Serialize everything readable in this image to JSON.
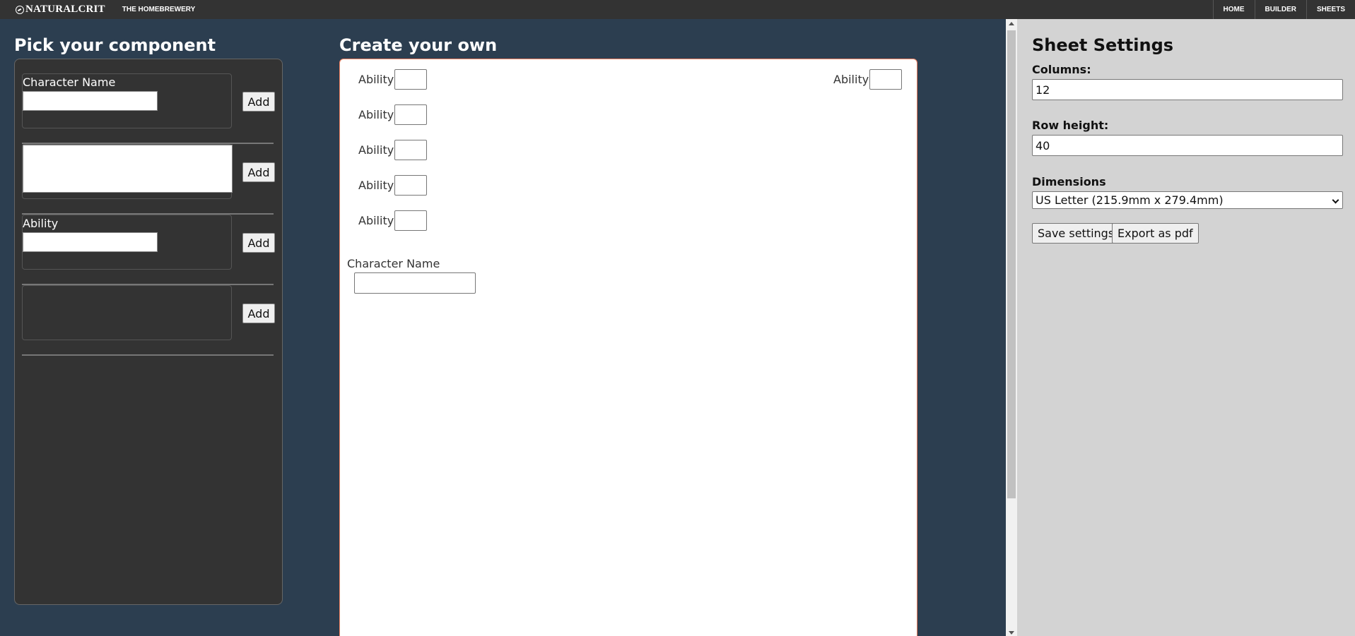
{
  "navbar": {
    "brand": "NATURALCRIT",
    "homebrewery": "THE HOMEBREWERY",
    "items": [
      {
        "label": "HOME"
      },
      {
        "label": "BUILDER"
      },
      {
        "label": "SHEETS"
      }
    ]
  },
  "left": {
    "title": "Pick your component",
    "components": [
      {
        "label": "Character Name",
        "add": "Add"
      },
      {
        "label": "",
        "add": "Add"
      },
      {
        "label": "Ability",
        "add": "Add"
      },
      {
        "label": "",
        "add": "Add"
      }
    ]
  },
  "center": {
    "title": "Create your own",
    "abilities": [
      "Ability",
      "Ability",
      "Ability",
      "Ability",
      "Ability",
      "Ability"
    ],
    "char_name_label": "Character Name"
  },
  "settings": {
    "title": "Sheet Settings",
    "columns_label": "Columns:",
    "columns_value": "12",
    "row_height_label": "Row height:",
    "row_height_value": "40",
    "dimensions_label": "Dimensions",
    "dimensions_value": "US Letter (215.9mm x 279.4mm)",
    "save_label": "Save settings",
    "export_label": "Export as pdf"
  }
}
